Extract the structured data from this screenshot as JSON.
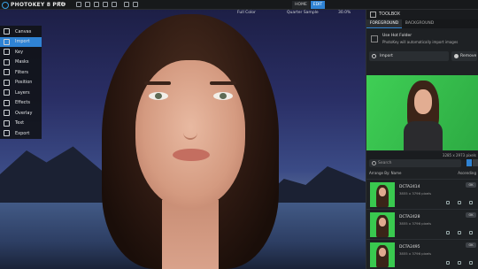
{
  "app": {
    "logo_text": "PHOTOKEY 8 PRO",
    "file_menu": "File"
  },
  "modes": {
    "home": "HOME",
    "edit": "EDIT"
  },
  "toolbar": {
    "color_mode": "Full Color",
    "sample_mode": "Quarter Sample",
    "zoom": "30.0%"
  },
  "tools": [
    {
      "label": "Canvas",
      "icon": "canvas-icon"
    },
    {
      "label": "Import",
      "icon": "import-icon"
    },
    {
      "label": "Key",
      "icon": "key-icon"
    },
    {
      "label": "Masks",
      "icon": "masks-icon"
    },
    {
      "label": "Filters",
      "icon": "filters-icon"
    },
    {
      "label": "Position",
      "icon": "position-icon"
    },
    {
      "label": "Layers",
      "icon": "layers-icon"
    },
    {
      "label": "Effects",
      "icon": "effects-icon"
    },
    {
      "label": "Overlay",
      "icon": "overlay-icon"
    },
    {
      "label": "Text",
      "icon": "text-icon"
    },
    {
      "label": "Export",
      "icon": "export-icon"
    }
  ],
  "active_tool": "Import",
  "panel": {
    "title": "TOOLBOX",
    "tabs": [
      "FOREGROUND",
      "BACKGROUND"
    ],
    "hot_folder": {
      "title": "Use Hot Folder",
      "subtitle": "PhotoKey will automatically import images"
    },
    "import_label": "Import",
    "remove_label": "Remove",
    "image_size": "3285 x 2973 pixels",
    "search_placeholder": "Search",
    "arrange_label": "Arrange By: Name",
    "sort_label": "Ascending"
  },
  "images": [
    {
      "name": "DCTA2414",
      "dims": "3855 x 3796 pixels",
      "badge": "OK"
    },
    {
      "name": "DCTA2428",
      "dims": "3855 x 3796 pixels",
      "badge": "OK"
    },
    {
      "name": "DCTA2495",
      "dims": "3855 x 3796 pixels",
      "badge": "OK"
    }
  ],
  "colors": {
    "accent": "#2f83d4",
    "green_screen": "#3fcf55"
  }
}
